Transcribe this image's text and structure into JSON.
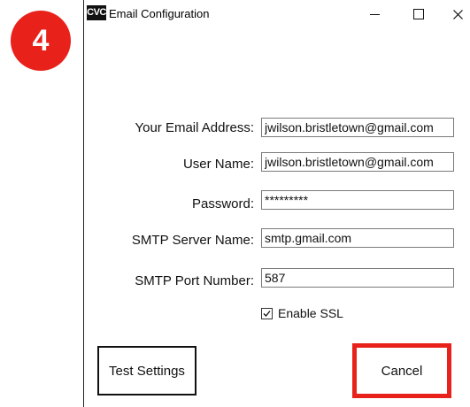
{
  "step_badge": "4",
  "window": {
    "app_icon_text": "CVC",
    "title": "Email Configuration",
    "controls": {
      "minimize_icon": "minimize-icon",
      "maximize_icon": "maximize-icon",
      "close_icon": "close-icon"
    }
  },
  "form": {
    "email_label": "Your Email Address:",
    "email_value": "jwilson.bristletown@gmail.com",
    "username_label": "User Name:",
    "username_value": "jwilson.bristletown@gmail.com",
    "password_label": "Password:",
    "password_value": "*********",
    "smtp_server_label": "SMTP Server Name:",
    "smtp_server_value": "smtp.gmail.com",
    "smtp_port_label": "SMTP Port Number:",
    "smtp_port_value": "587",
    "ssl_label": "Enable SSL",
    "ssl_checked": true
  },
  "buttons": {
    "test_label": "Test Settings",
    "cancel_label": "Cancel"
  },
  "colors": {
    "highlight": "#e8211b"
  }
}
